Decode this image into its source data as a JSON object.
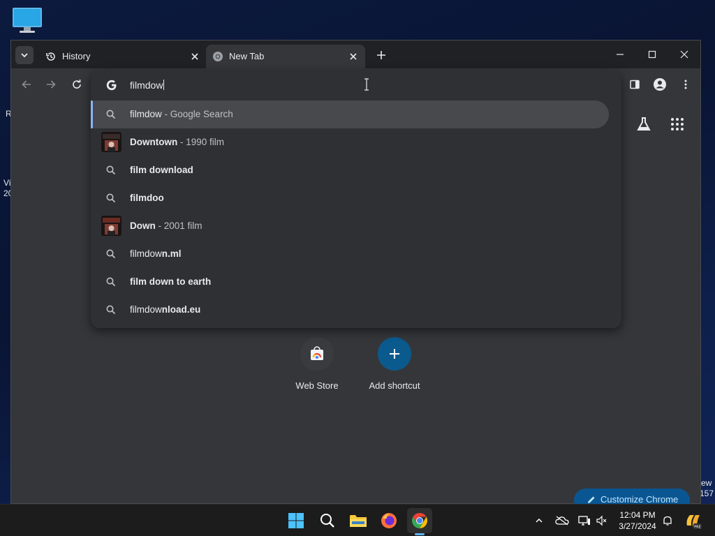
{
  "desktop": {
    "fragments": [
      "R",
      "Vi",
      "20",
      "ew",
      "157"
    ]
  },
  "tabs": [
    {
      "label": "History",
      "icon": "history-icon"
    },
    {
      "label": "New Tab",
      "icon": "chrome-icon"
    }
  ],
  "omnibox": {
    "value": "filmdow",
    "suggestions": [
      {
        "type": "search",
        "icon": "search-icon",
        "parts": [
          {
            "t": "filmdow",
            "bold": false
          },
          {
            "t": " - Google Search",
            "dim": true
          }
        ]
      },
      {
        "type": "entity",
        "icon": "movie-thumbnail",
        "parts": [
          {
            "t": "Downtown",
            "bold": true
          },
          {
            "t": " - 1990 film",
            "dim": true
          }
        ]
      },
      {
        "type": "search",
        "icon": "search-icon",
        "parts": [
          {
            "t": "film download",
            "bold": true
          }
        ]
      },
      {
        "type": "search",
        "icon": "search-icon",
        "parts": [
          {
            "t": "filmdoo",
            "bold": true
          }
        ]
      },
      {
        "type": "entity",
        "icon": "movie-thumbnail",
        "parts": [
          {
            "t": "Down",
            "bold": true
          },
          {
            "t": " - 2001 film",
            "dim": true
          }
        ]
      },
      {
        "type": "search",
        "icon": "search-icon",
        "parts": [
          {
            "t": "filmdow",
            "bold": false
          },
          {
            "t": "n.ml",
            "bold": true
          }
        ]
      },
      {
        "type": "search",
        "icon": "search-icon",
        "parts": [
          {
            "t": "film down to earth",
            "bold": true
          }
        ]
      },
      {
        "type": "search",
        "icon": "search-icon",
        "parts": [
          {
            "t": "filmdow",
            "bold": false
          },
          {
            "t": "nload.eu",
            "bold": true
          }
        ]
      }
    ]
  },
  "ntp": {
    "shortcuts": [
      {
        "label": "Web Store",
        "icon": "webstore-icon"
      },
      {
        "label": "Add shortcut",
        "icon": "plus-icon"
      }
    ],
    "customize_label": "Customize Chrome"
  },
  "taskbar": {
    "time": "12:04 PM",
    "date": "3/27/2024"
  },
  "colors": {
    "accent": "#8ab4f8",
    "chrome_bg": "#35363a",
    "tabstrip": "#202124",
    "omnibox_bg": "#2f3033",
    "add_shortcut": "#0b5a8e"
  }
}
